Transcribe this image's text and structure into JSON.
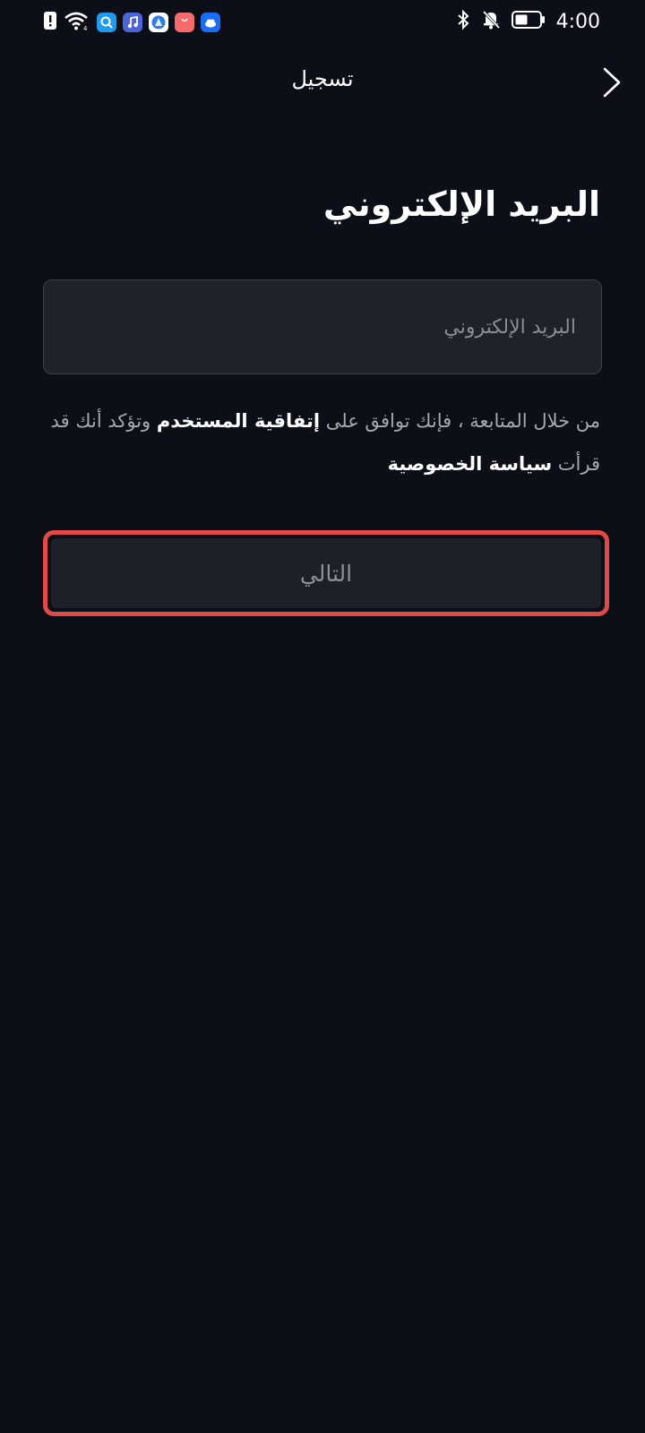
{
  "status_bar": {
    "time": "4:00",
    "left_icons": [
      "alert-icon",
      "wifi-icon",
      "search-app-icon",
      "music-app-icon",
      "browser-app-icon",
      "shop-app-icon",
      "cloud-app-icon"
    ],
    "right_icons": [
      "bluetooth-icon",
      "mute-bell-icon",
      "battery-icon"
    ]
  },
  "header": {
    "title": "تسجيل",
    "back_icon": "chevron-right-icon"
  },
  "form": {
    "title": "البريد الإلكتروني",
    "email_placeholder": "البريد الإلكتروني",
    "email_value": ""
  },
  "terms": {
    "part1": "من خلال المتابعة ، فإنك توافق على ",
    "user_agreement": "إتفاقية المستخدم",
    "part2": "  وتؤكد أنك قد قرأت ",
    "privacy_policy": "سياسة الخصوصية"
  },
  "next_button": {
    "label": "التالي"
  },
  "colors": {
    "background": "#0c0f18",
    "input_bg": "#1f222b",
    "button_bg": "#1d2029",
    "highlight_border": "#e24a48"
  }
}
